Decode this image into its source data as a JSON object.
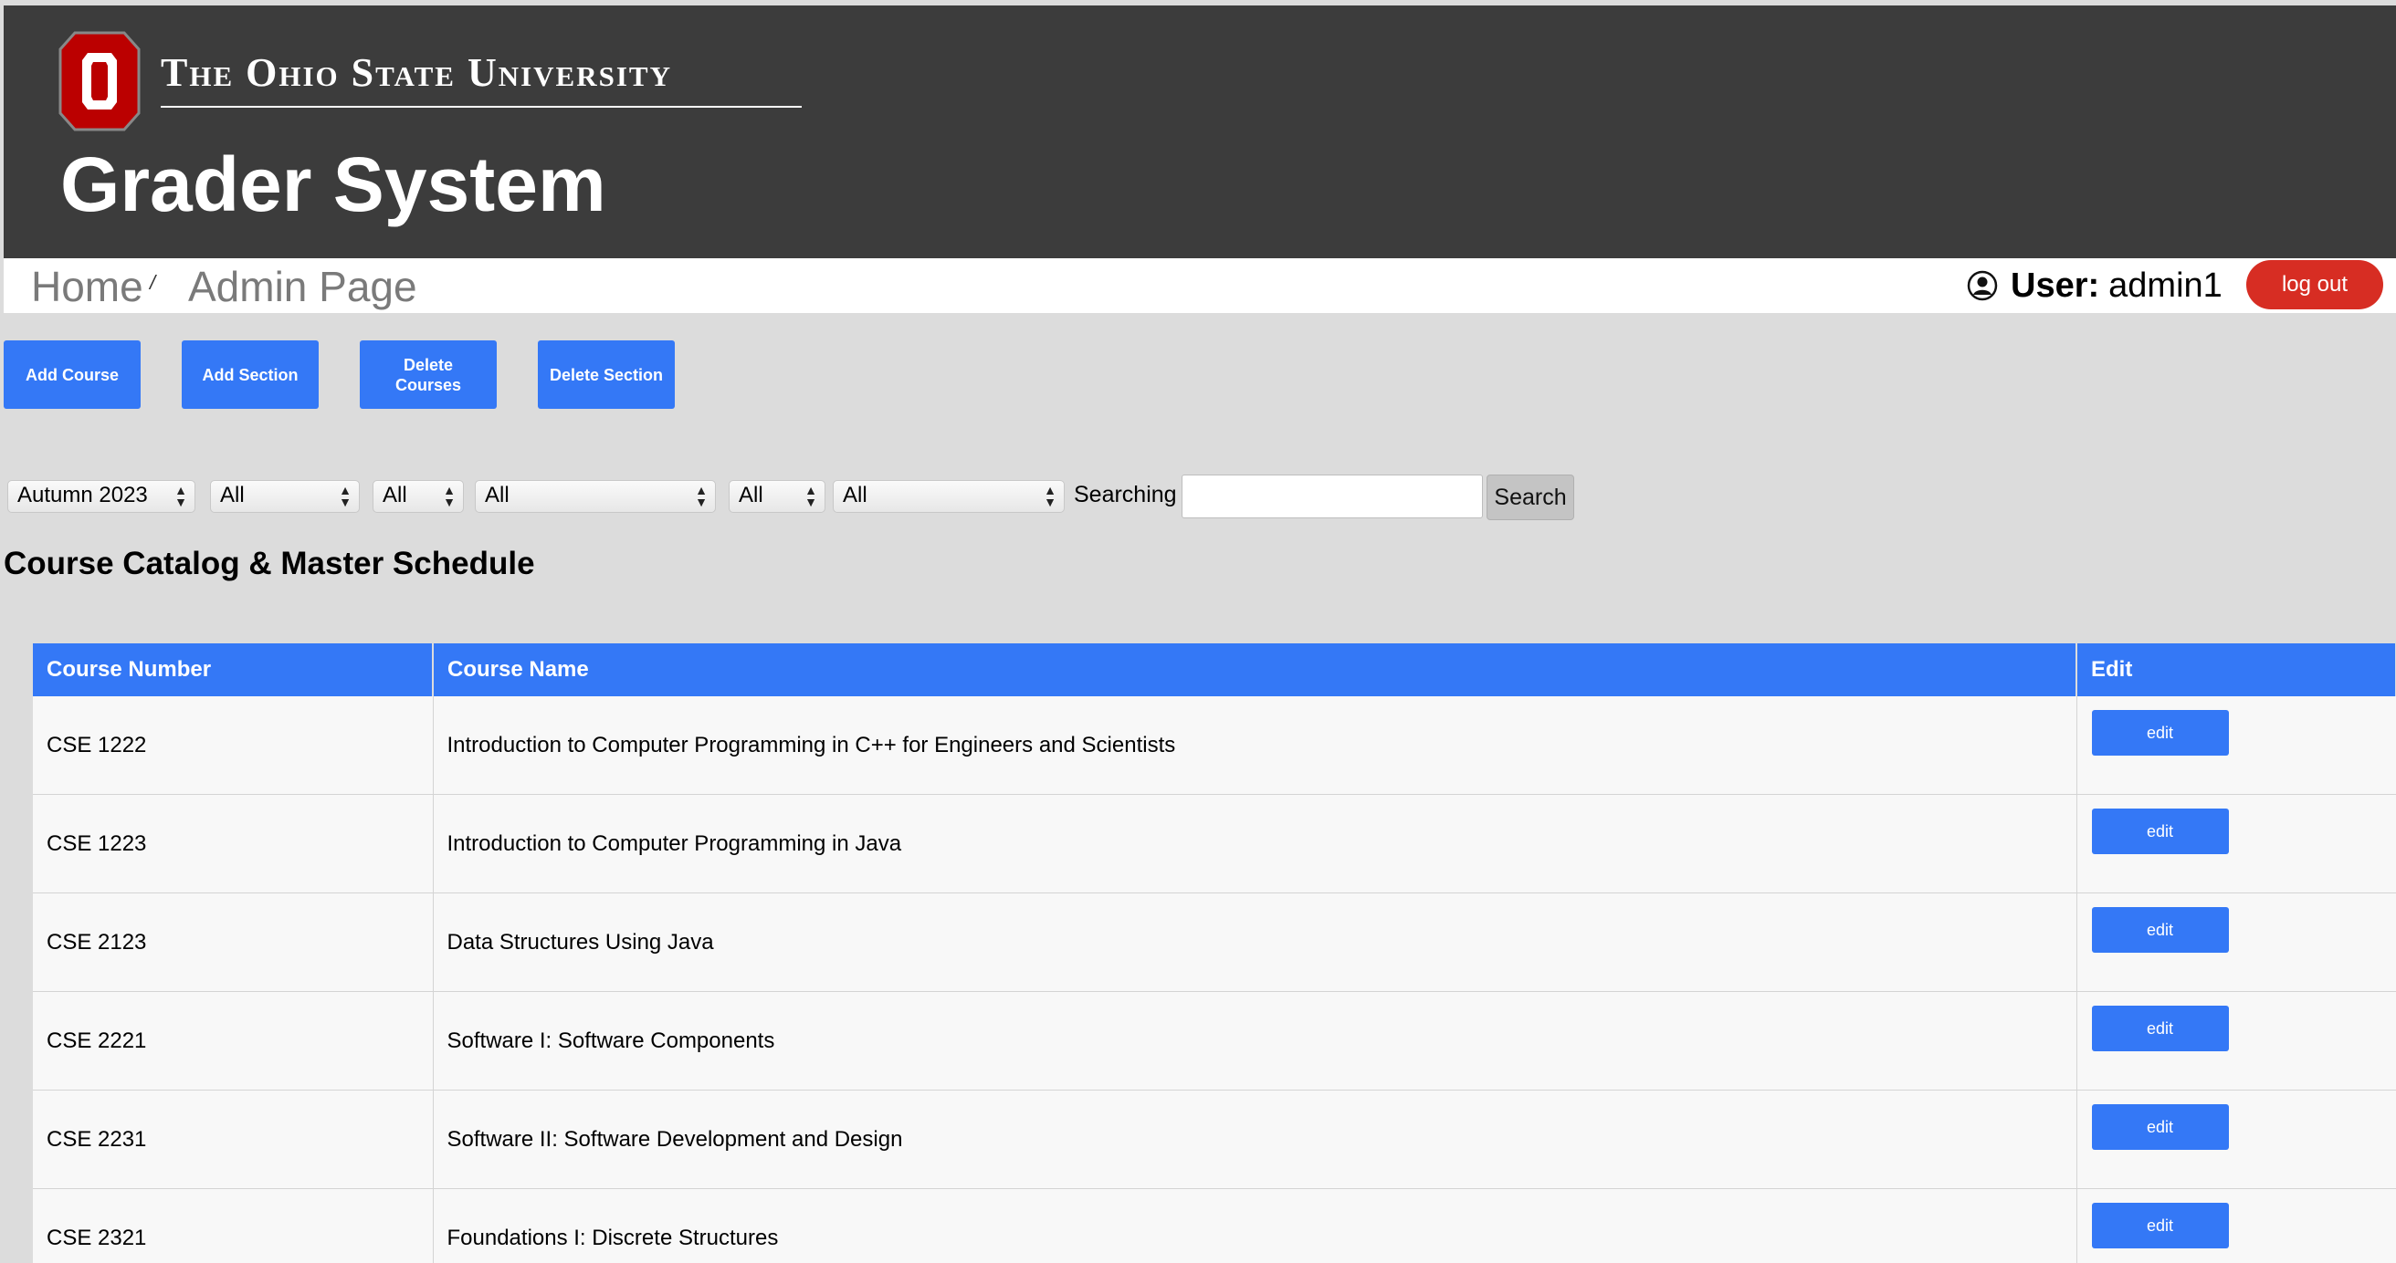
{
  "header": {
    "university": "The Ohio State University",
    "app_title": "Grader System",
    "brand_color": "#bb0000"
  },
  "nav": {
    "home": "Home",
    "separator": "/",
    "current": "Admin Page",
    "user_label": "User:",
    "user_name": "admin1",
    "logout": "log out"
  },
  "actions": {
    "add_course": "Add Course",
    "add_section": "Add Section",
    "delete_courses": "Delete Courses",
    "delete_section": "Delete Section"
  },
  "filters": {
    "term": "Autumn 2023",
    "f1": "All",
    "f2": "All",
    "f3": "All",
    "f4": "All",
    "f5": "All",
    "search_label": "Searching",
    "search_value": "",
    "search_button": "Search"
  },
  "section_title": "Course Catalog & Master Schedule",
  "table": {
    "headers": [
      "Course Number",
      "Course Name",
      "Edit"
    ],
    "edit_label": "edit",
    "rows": [
      {
        "number": "CSE 1222",
        "name": "Introduction to Computer Programming in C++ for Engineers and Scientists"
      },
      {
        "number": "CSE 1223",
        "name": "Introduction to Computer Programming in Java"
      },
      {
        "number": "CSE 2123",
        "name": "Data Structures Using Java"
      },
      {
        "number": "CSE 2221",
        "name": "Software I: Software Components"
      },
      {
        "number": "CSE 2231",
        "name": "Software II: Software Development and Design"
      },
      {
        "number": "CSE 2321",
        "name": "Foundations I: Discrete Structures"
      }
    ]
  },
  "colors": {
    "header_bg": "#3c3c3c",
    "accent_blue": "#3478f6",
    "logout_red": "#d72d23"
  }
}
